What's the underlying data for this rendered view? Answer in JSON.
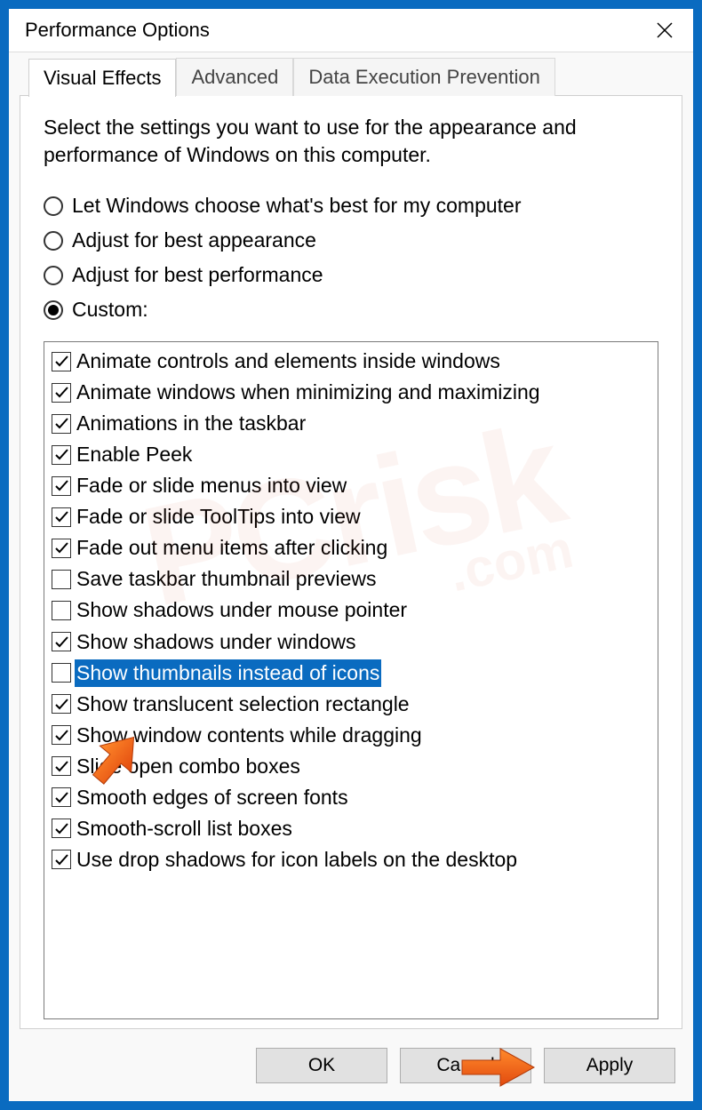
{
  "window": {
    "title": "Performance Options"
  },
  "tabs": [
    {
      "label": "Visual Effects",
      "active": true
    },
    {
      "label": "Advanced",
      "active": false
    },
    {
      "label": "Data Execution Prevention",
      "active": false
    }
  ],
  "description": "Select the settings you want to use for the appearance and performance of Windows on this computer.",
  "radios": [
    {
      "label": "Let Windows choose what's best for my computer",
      "selected": false
    },
    {
      "label": "Adjust for best appearance",
      "selected": false
    },
    {
      "label": "Adjust for best performance",
      "selected": false
    },
    {
      "label": "Custom:",
      "selected": true
    }
  ],
  "options": [
    {
      "label": "Animate controls and elements inside windows",
      "checked": true,
      "highlighted": false
    },
    {
      "label": "Animate windows when minimizing and maximizing",
      "checked": true,
      "highlighted": false
    },
    {
      "label": "Animations in the taskbar",
      "checked": true,
      "highlighted": false
    },
    {
      "label": "Enable Peek",
      "checked": true,
      "highlighted": false
    },
    {
      "label": "Fade or slide menus into view",
      "checked": true,
      "highlighted": false
    },
    {
      "label": "Fade or slide ToolTips into view",
      "checked": true,
      "highlighted": false
    },
    {
      "label": "Fade out menu items after clicking",
      "checked": true,
      "highlighted": false
    },
    {
      "label": "Save taskbar thumbnail previews",
      "checked": false,
      "highlighted": false
    },
    {
      "label": "Show shadows under mouse pointer",
      "checked": false,
      "highlighted": false
    },
    {
      "label": "Show shadows under windows",
      "checked": true,
      "highlighted": false
    },
    {
      "label": "Show thumbnails instead of icons",
      "checked": false,
      "highlighted": true
    },
    {
      "label": "Show translucent selection rectangle",
      "checked": true,
      "highlighted": false
    },
    {
      "label": "Show window contents while dragging",
      "checked": true,
      "highlighted": false
    },
    {
      "label": "Slide open combo boxes",
      "checked": true,
      "highlighted": false
    },
    {
      "label": "Smooth edges of screen fonts",
      "checked": true,
      "highlighted": false
    },
    {
      "label": "Smooth-scroll list boxes",
      "checked": true,
      "highlighted": false
    },
    {
      "label": "Use drop shadows for icon labels on the desktop",
      "checked": true,
      "highlighted": false
    }
  ],
  "buttons": {
    "ok": "OK",
    "cancel": "Cancel",
    "apply": "Apply"
  }
}
